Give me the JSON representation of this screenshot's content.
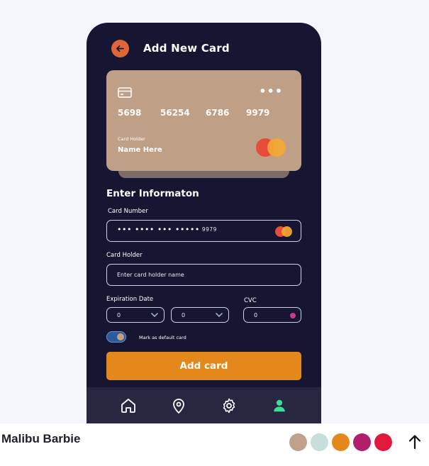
{
  "screen": {
    "title": "Add New Card",
    "card": {
      "number_groups": [
        "5698",
        "56254",
        "6786",
        "9979"
      ],
      "holder_caption": "Card Holder",
      "holder_name": "Name Here",
      "menu_dots": "•••"
    },
    "form": {
      "section_title": "Enter Informaton",
      "card_number_label": "Card Number",
      "card_number_mask": "••• •••• ••• •••••",
      "card_number_last4": "9979",
      "card_holder_label": "Card Holder",
      "card_holder_placeholder": "Enter card holder name",
      "expiration_label": "Expiration Date",
      "month_value": "0",
      "year_value": "0",
      "cvc_label": "CVC",
      "cvc_value": "0",
      "default_toggle_label": "Mark as default card",
      "default_toggle_on": true,
      "submit_label": "Add card"
    },
    "bottom_nav": {
      "items": [
        "home-icon",
        "location-pin-icon",
        "gear-icon",
        "user-icon"
      ],
      "active": "user-icon"
    }
  },
  "footer": {
    "theme_name": "Malibu Barbie",
    "palette": [
      "#c0a28c",
      "#c7dedc",
      "#e5881b",
      "#b01e6c",
      "#df1a3d"
    ]
  },
  "colors": {
    "background": "#161633",
    "card": "#bf9f86",
    "accent": "#e5881b",
    "back_button": "#e0663a",
    "active_nav": "#3ddc97"
  }
}
